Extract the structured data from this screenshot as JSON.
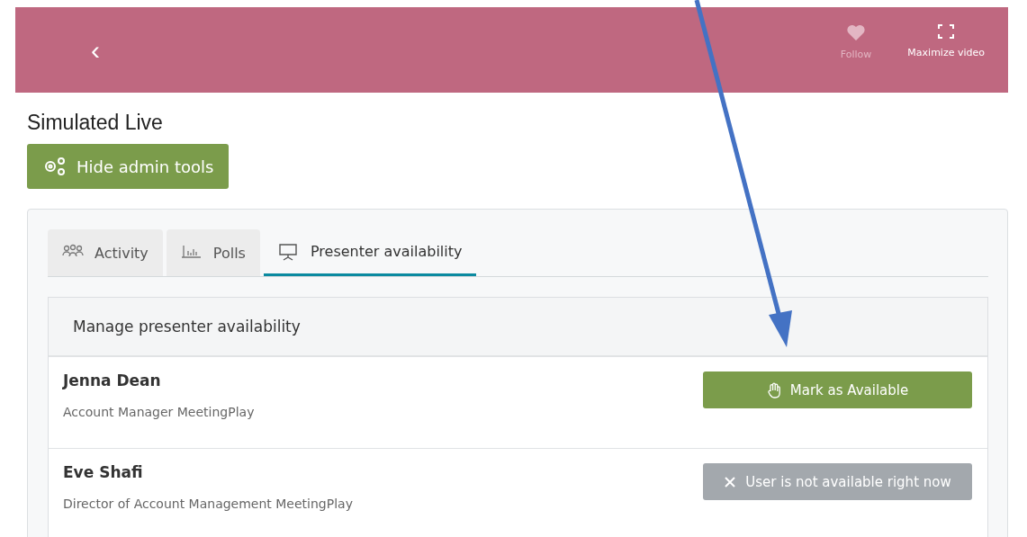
{
  "header": {
    "back": "‹",
    "actions": [
      {
        "kind": "follow",
        "label": "Follow",
        "disabled": true
      },
      {
        "kind": "maximize",
        "label": "Maximize video",
        "disabled": false
      }
    ]
  },
  "title": "Simulated Live",
  "admin_button": "Hide admin tools",
  "tabs": [
    {
      "kind": "activity",
      "label": "Activity",
      "selected": false
    },
    {
      "kind": "polls",
      "label": "Polls",
      "selected": false
    },
    {
      "kind": "presenter",
      "label": "Presenter availability",
      "selected": true
    }
  ],
  "card": {
    "title": "Manage presenter availability",
    "presenters": [
      {
        "name": "Jenna Dean",
        "role": "Account Manager MeetingPlay",
        "action": {
          "kind": "mark",
          "label": "Mark as Available"
        }
      },
      {
        "name": "Eve Shafi",
        "role": "Director of Account Management MeetingPlay",
        "action": {
          "kind": "unavailable",
          "label": "User is not available right now"
        }
      }
    ]
  }
}
